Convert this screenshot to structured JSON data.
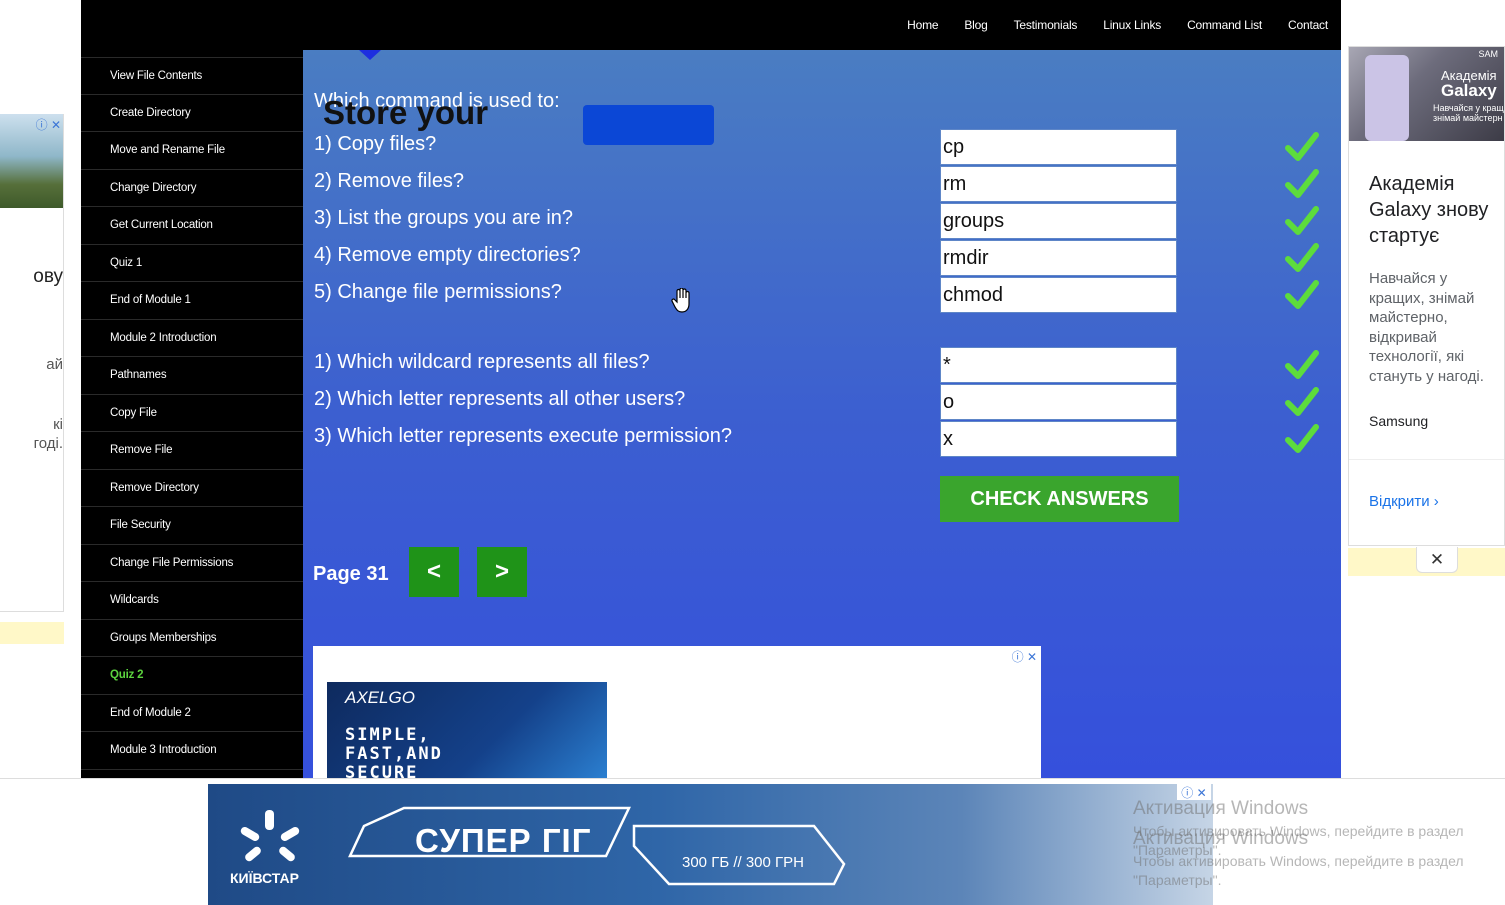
{
  "nav": {
    "items": [
      "Home",
      "Blog",
      "Testimonials",
      "Linux Links",
      "Command List",
      "Contact"
    ]
  },
  "sidebar": {
    "items": [
      {
        "label": "View File Contents",
        "active": false
      },
      {
        "label": "Create Directory",
        "active": false
      },
      {
        "label": "Move and Rename File",
        "active": false
      },
      {
        "label": "Change Directory",
        "active": false
      },
      {
        "label": "Get Current Location",
        "active": false
      },
      {
        "label": "Quiz 1",
        "active": false
      },
      {
        "label": "End of Module 1",
        "active": false
      },
      {
        "label": "Module 2 Introduction",
        "active": false
      },
      {
        "label": "Pathnames",
        "active": false
      },
      {
        "label": "Copy File",
        "active": false
      },
      {
        "label": "Remove File",
        "active": false
      },
      {
        "label": "Remove Directory",
        "active": false
      },
      {
        "label": "File Security",
        "active": false
      },
      {
        "label": "Change File Permissions",
        "active": false
      },
      {
        "label": "Wildcards",
        "active": false
      },
      {
        "label": "Groups Memberships",
        "active": false
      },
      {
        "label": "Quiz 2",
        "active": true
      },
      {
        "label": "End of Module 2",
        "active": false
      },
      {
        "label": "Module 3 Introduction",
        "active": false
      }
    ]
  },
  "quiz": {
    "heading": "Which command is used to:",
    "section1": [
      {
        "question": "1) Copy files?",
        "answer": "cp",
        "correct": true
      },
      {
        "question": "2) Remove files?",
        "answer": "rm",
        "correct": true
      },
      {
        "question": "3) List the groups you are in?",
        "answer": "groups",
        "correct": true
      },
      {
        "question": "4) Remove empty directories?",
        "answer": "rmdir",
        "correct": true
      },
      {
        "question": "5) Change file permissions?",
        "answer": "chmod",
        "correct": true
      }
    ],
    "section2": [
      {
        "question": "1) Which wildcard represents all files?",
        "answer": "*",
        "correct": true
      },
      {
        "question": "2) Which letter represents all other users?",
        "answer": "o",
        "correct": true
      },
      {
        "question": "3) Which letter represents execute permission?",
        "answer": "x",
        "correct": true
      }
    ],
    "check_button": "CHECK ANSWERS",
    "page_label": "Page 31",
    "prev_label": "<",
    "next_label": ">"
  },
  "inline_ad": {
    "brand": "AXELGO",
    "tagline": "SIMPLE,\nFAST,AND\nSECURE",
    "headline": "Store your",
    "adchoices": "ⓘ ✕"
  },
  "left_ad": {
    "icons": "ⓘ ✕",
    "fragments": [
      "ову",
      "ай",
      "кі",
      "годі."
    ]
  },
  "right_ad": {
    "image_brand": "SAM",
    "image_line1": "Академія",
    "image_line2": "Galaxy",
    "image_line3": "Навчайся у кращ\nзнімай майстерн",
    "headline": "Академія Galaxy знову стартує",
    "body": "Навчайся у кращих, знімай майстерно, відкривай технології, які стануть у нагоді.",
    "advertiser": "Samsung",
    "cta": "Відкрити",
    "close": "✕"
  },
  "bottom_ad": {
    "brand": "КИЇВСТАР",
    "title": "СУПЕР ГІГ",
    "price": "300 ГБ // 300 ГРН",
    "icons": "ⓘ ✕"
  },
  "watermark": {
    "title": "Активация Windows",
    "line1": "Чтобы активировать Windows, перейдите в раздел",
    "line2": "\"Параметры\"."
  },
  "colors": {
    "correct_check": "#5ddc3c",
    "check_button": "#3aa52d",
    "nav_button": "#1f9318",
    "active_sidebar": "#5cd33f"
  }
}
